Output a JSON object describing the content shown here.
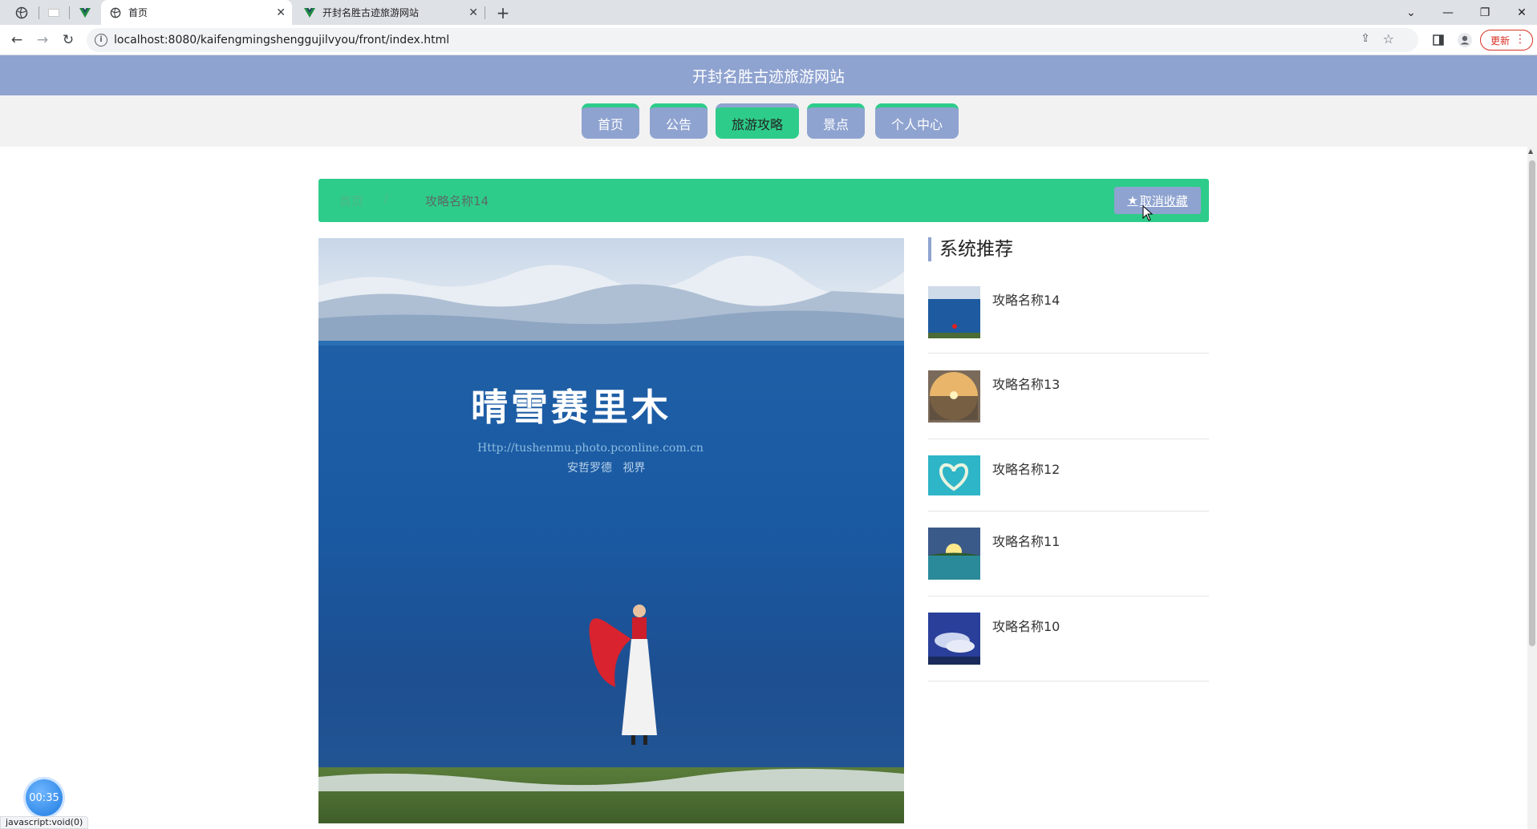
{
  "browser": {
    "tabs": [
      {
        "title": "首页",
        "active": true
      },
      {
        "title": "开封名胜古迹旅游网站",
        "active": false
      }
    ],
    "url": "localhost:8080/kaifengmingshenggujilvyou/front/index.html",
    "update_label": "更新",
    "status_text": "javascript:void(0)"
  },
  "site": {
    "title": "开封名胜古迹旅游网站",
    "nav": [
      {
        "label": "首页",
        "active": false
      },
      {
        "label": "公告",
        "active": false
      },
      {
        "label": "旅游攻略",
        "active": true
      },
      {
        "label": "景点",
        "active": false
      },
      {
        "label": "个人中心",
        "active": false
      }
    ]
  },
  "breadcrumb": {
    "home": "首页",
    "separator": "/",
    "current": "攻略名称14"
  },
  "favorite_button": {
    "icon": "star-icon",
    "label": "取消收藏"
  },
  "watermark": {
    "line1": "晴雪赛里木",
    "line2": "Http://tushenmu.photo.pconline.com.cn",
    "line3": "安哲罗德   视界"
  },
  "recommend": {
    "heading": "系统推荐",
    "items": [
      {
        "title": "攻略名称14",
        "thumb": "lake-dancer"
      },
      {
        "title": "攻略名称13",
        "thumb": "sunset-sphere"
      },
      {
        "title": "攻略名称12",
        "thumb": "heart-island"
      },
      {
        "title": "攻略名称11",
        "thumb": "sunrise-lake"
      },
      {
        "title": "攻略名称10",
        "thumb": "blue-clouds"
      }
    ]
  },
  "timer": "00:35",
  "colors": {
    "header": "#8fa3d0",
    "accent": "#2ecc8a"
  }
}
